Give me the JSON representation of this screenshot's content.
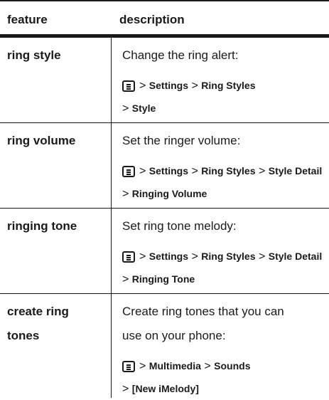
{
  "header": {
    "col1": "feature",
    "col2": "description"
  },
  "rows": [
    {
      "feature": [
        "ring style"
      ],
      "description": [
        "Change the ring alert:"
      ],
      "path": [
        [
          "Settings",
          "Ring Styles"
        ],
        [
          "Style"
        ]
      ]
    },
    {
      "feature": [
        "ring volume"
      ],
      "description": [
        "Set the ringer volume:"
      ],
      "path": [
        [
          "Settings",
          "Ring Styles",
          "Style Detail"
        ],
        [
          "Ringing Volume"
        ]
      ]
    },
    {
      "feature": [
        "ringing tone"
      ],
      "description": [
        "Set ring tone melody:"
      ],
      "path": [
        [
          "Settings",
          "Ring Styles",
          "Style Detail"
        ],
        [
          "Ringing Tone"
        ]
      ]
    },
    {
      "feature": [
        "create ring",
        "tones"
      ],
      "description": [
        "Create ring tones that you can",
        "use on your phone:"
      ],
      "path": [
        [
          "Multimedia",
          "Sounds"
        ],
        [
          "[New iMelody]"
        ]
      ]
    }
  ],
  "separator": ">",
  "menu_icon": "menu-key-icon"
}
